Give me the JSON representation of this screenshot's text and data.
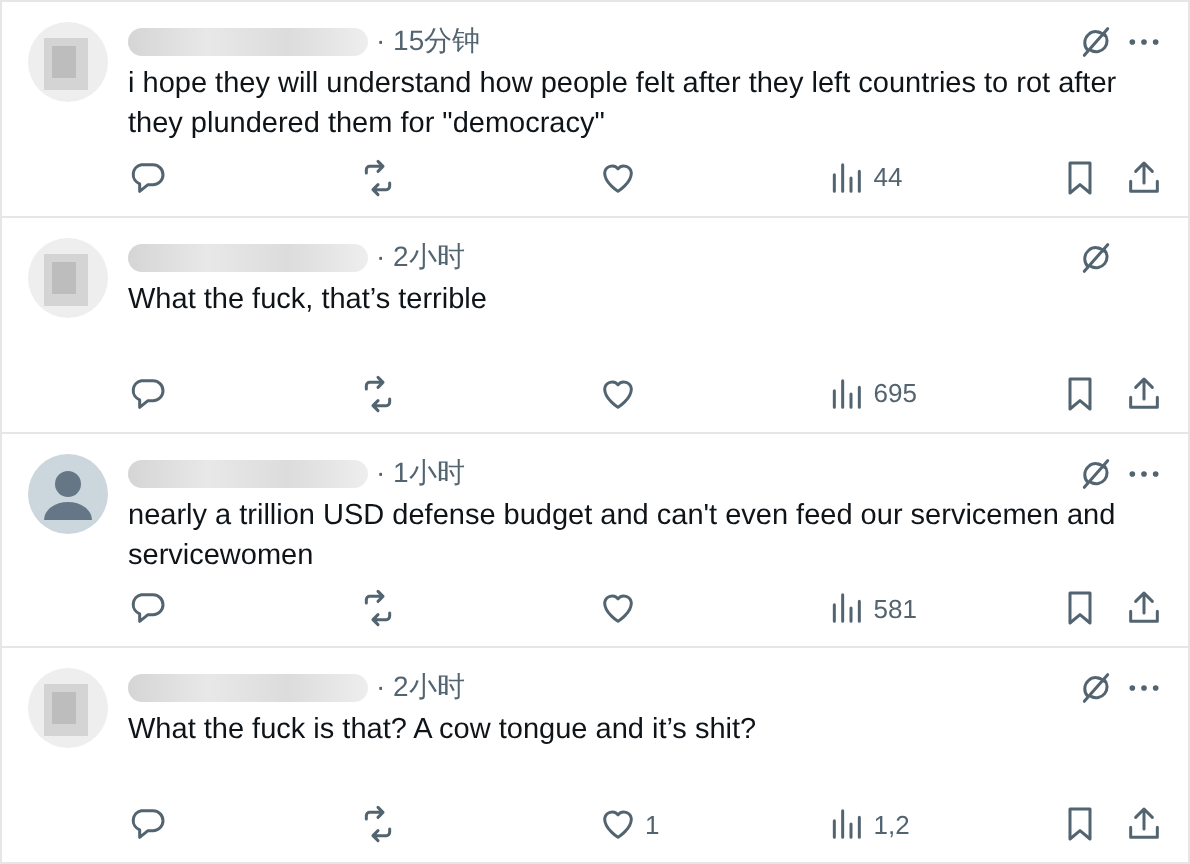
{
  "replies": [
    {
      "avatar": {
        "kind": "blurred"
      },
      "time": "· 15分钟",
      "more_menu": true,
      "text": "i hope they will understand how people felt after they left countries to rot after they plundered them for \"democracy\"",
      "views": "44"
    },
    {
      "avatar": {
        "kind": "blurred"
      },
      "time": "· 2小时",
      "more_menu": false,
      "text": "What the fuck, that’s terrible",
      "views": "695"
    },
    {
      "avatar": {
        "kind": "default"
      },
      "time": "· 1小时",
      "more_menu": true,
      "text": "nearly a trillion USD defense budget and can't even feed our servicemen and servicewomen",
      "views": "581"
    },
    {
      "avatar": {
        "kind": "blurred"
      },
      "time": "· 2小时",
      "more_menu": true,
      "text": "What the fuck is that? A cow tongue and it’s shit?",
      "likes": "1",
      "views": "1,2"
    }
  ]
}
